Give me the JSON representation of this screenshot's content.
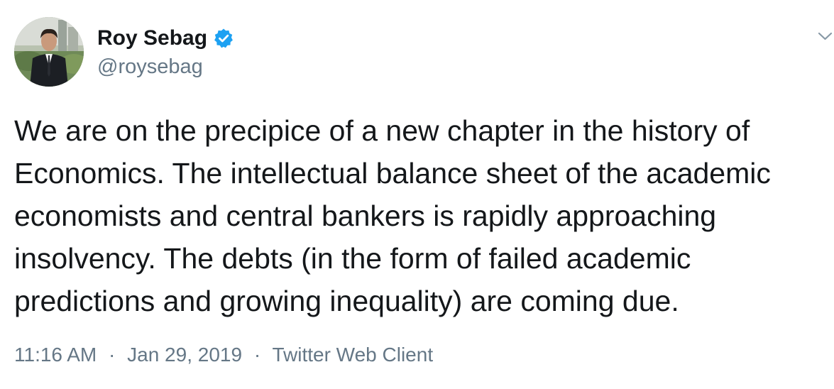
{
  "tweet": {
    "author": {
      "display_name": "Roy Sebag",
      "handle": "@roysebag",
      "verified": true,
      "avatar_icon": "profile-photo-avatar"
    },
    "text_lines": [
      "We are on the precipice of a new chapter in the history of",
      "Economics. The intellectual balance sheet of the academic",
      "economists and central bankers is rapidly approaching",
      "insolvency. The debts (in the form of failed academic",
      "predictions and growing inequality) are coming due."
    ],
    "meta": {
      "time": "11:16 AM",
      "date": "Jan 29, 2019",
      "source": "Twitter Web Client",
      "separator": "·"
    },
    "menu_icon": "chevron-down-icon"
  },
  "colors": {
    "text": "#14171a",
    "secondary": "#657786",
    "verified_blue": "#1da1f2",
    "background": "#ffffff"
  }
}
